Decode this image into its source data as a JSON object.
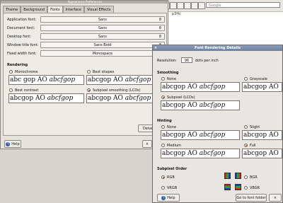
{
  "app_window": {
    "title": "Appearance Preferences",
    "tabs": [
      "Theme",
      "Background",
      "Fonts",
      "Interface",
      "Visual Effects"
    ],
    "active_tab": 2,
    "fonts": [
      {
        "label": "Application font:",
        "value": "Sans",
        "size": "8"
      },
      {
        "label": "Document font:",
        "value": "Sans",
        "size": "8"
      },
      {
        "label": "Desktop font:",
        "value": "Sans",
        "size": "8"
      },
      {
        "label": "Window title font:",
        "value": "Sans Bold",
        "size": "8"
      },
      {
        "label": "Fixed width font:",
        "value": "Monospace",
        "size": "8"
      }
    ],
    "rendering_heading": "Rendering",
    "rendering_options": [
      {
        "label": "Monochrome",
        "selected": false
      },
      {
        "label": "Best shapes",
        "selected": false
      },
      {
        "label": "Best contrast",
        "selected": false
      },
      {
        "label": "Subpixel smoothing (LCDs)",
        "selected": true
      }
    ],
    "sample_text": "abc",
    "sample_text_2": "gop",
    "sample_text_3": "AO",
    "sample_text_4": "abcfgop",
    "details_button": "Details...",
    "help_button": "Help",
    "close_button": "Close"
  },
  "browser_bg": {
    "search_placeholder": "Google",
    "fragment_text": "p3Hc"
  },
  "dialog": {
    "title": "Font Rendering Details",
    "resolution_label": "Resolution:",
    "resolution_value": "96",
    "resolution_unit": "dots per inch",
    "smoothing_heading": "Smoothing",
    "smoothing_options": [
      {
        "label": "None",
        "selected": false
      },
      {
        "label": "Grayscale",
        "selected": false
      },
      {
        "label": "Subpixel (LCDs)",
        "selected": true
      }
    ],
    "hinting_heading": "Hinting",
    "hinting_options": [
      {
        "label": "None",
        "selected": false
      },
      {
        "label": "Slight",
        "selected": false
      },
      {
        "label": "Medium",
        "selected": false
      },
      {
        "label": "Full",
        "selected": true
      }
    ],
    "subpixel_heading": "Subpixel Order",
    "subpixel_options": [
      {
        "label": "RGB",
        "selected": true
      },
      {
        "label": "BGR",
        "selected": false
      },
      {
        "label": "VRGB",
        "selected": false
      },
      {
        "label": "VBGR",
        "selected": false
      }
    ],
    "help_button": "Help",
    "goto_button": "Go to font folder",
    "close_button": "Close",
    "colors": {
      "red": "#e11b1b",
      "green": "#1fae1f",
      "blue": "#2236d8"
    }
  }
}
